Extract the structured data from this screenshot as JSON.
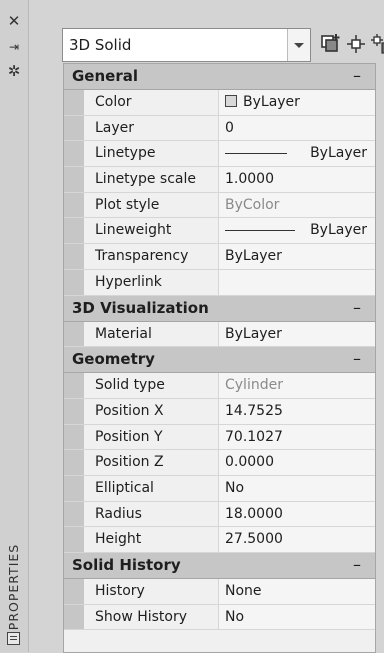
{
  "side_panel": {
    "close_glyph": "✕",
    "pin_glyph": "⇥",
    "settings_glyph": "✲",
    "vertical_title": "PROPERTIES"
  },
  "selection_dropdown": {
    "value": "3D Solid"
  },
  "toolbar": {
    "icons": [
      "toggle-pickadd-icon",
      "select-objects-icon",
      "quick-select-icon"
    ]
  },
  "sections": {
    "general": {
      "title": "General",
      "collapse_glyph": "–",
      "rows": [
        {
          "label": "Color",
          "value": "ByLayer"
        },
        {
          "label": "Layer",
          "value": "0"
        },
        {
          "label": "Linetype",
          "value": "ByLayer"
        },
        {
          "label": "Linetype scale",
          "value": "1.0000"
        },
        {
          "label": "Plot style",
          "value": "ByColor"
        },
        {
          "label": "Lineweight",
          "value": "ByLayer"
        },
        {
          "label": "Transparency",
          "value": "ByLayer"
        },
        {
          "label": "Hyperlink",
          "value": ""
        }
      ]
    },
    "visualization": {
      "title": "3D Visualization",
      "collapse_glyph": "–",
      "rows": [
        {
          "label": "Material",
          "value": "ByLayer"
        }
      ]
    },
    "geometry": {
      "title": "Geometry",
      "collapse_glyph": "–",
      "rows": [
        {
          "label": "Solid type",
          "value": "Cylinder"
        },
        {
          "label": "Position X",
          "value": "14.7525"
        },
        {
          "label": "Position Y",
          "value": "70.1027"
        },
        {
          "label": "Position Z",
          "value": "0.0000"
        },
        {
          "label": "Elliptical",
          "value": "No"
        },
        {
          "label": "Radius",
          "value": "18.0000"
        },
        {
          "label": "Height",
          "value": "27.5000"
        }
      ]
    },
    "history": {
      "title": "Solid History",
      "collapse_glyph": "–",
      "rows": [
        {
          "label": "History",
          "value": "None"
        },
        {
          "label": "Show History",
          "value": "No"
        }
      ]
    }
  }
}
